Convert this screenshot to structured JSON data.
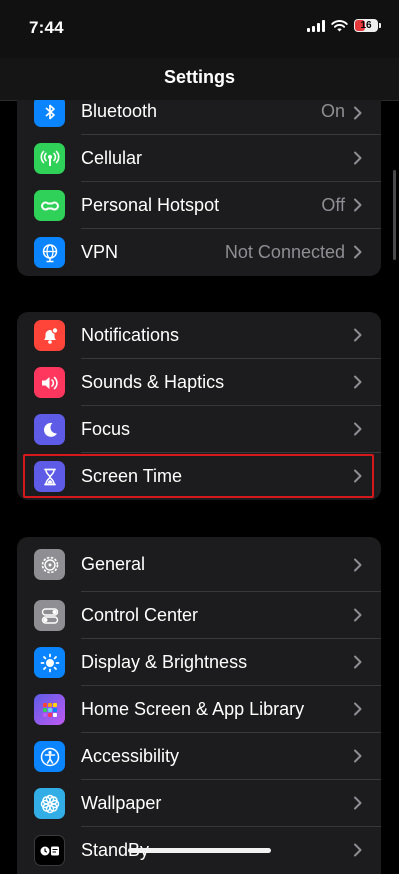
{
  "status_bar": {
    "time": "7:44",
    "battery": "16",
    "icons": [
      "cellular-signal-icon",
      "wifi-icon",
      "battery-icon"
    ]
  },
  "nav": {
    "title": "Settings"
  },
  "groups": [
    {
      "rows": [
        {
          "label": "Bluetooth",
          "value": "On",
          "icon": "bluetooth-icon",
          "color": "#0a84ff"
        },
        {
          "label": "Cellular",
          "value": "",
          "icon": "cellular-icon",
          "color": "#30d158"
        },
        {
          "label": "Personal Hotspot",
          "value": "Off",
          "icon": "hotspot-icon",
          "color": "#30d158"
        },
        {
          "label": "VPN",
          "value": "Not Connected",
          "icon": "vpn-globe-icon",
          "color": "#0a84ff"
        }
      ]
    },
    {
      "rows": [
        {
          "label": "Notifications",
          "value": "",
          "icon": "bell-icon",
          "color": "#ff453a"
        },
        {
          "label": "Sounds & Haptics",
          "value": "",
          "icon": "speaker-icon",
          "color": "#ff375f"
        },
        {
          "label": "Focus",
          "value": "",
          "icon": "moon-icon",
          "color": "#5e5ce6"
        },
        {
          "label": "Screen Time",
          "value": "",
          "icon": "hourglass-icon",
          "color": "#5e5ce6",
          "highlighted": true
        }
      ]
    },
    {
      "rows": [
        {
          "label": "General",
          "value": "",
          "icon": "gear-icon",
          "color": "#8e8e93"
        },
        {
          "label": "Control Center",
          "value": "",
          "icon": "toggles-icon",
          "color": "#8e8e93"
        },
        {
          "label": "Display & Brightness",
          "value": "",
          "icon": "sun-icon",
          "color": "#0a84ff"
        },
        {
          "label": "Home Screen & App Library",
          "value": "",
          "icon": "app-grid-icon",
          "color": "#5e5ce6"
        },
        {
          "label": "Accessibility",
          "value": "",
          "icon": "accessibility-icon",
          "color": "#0a84ff"
        },
        {
          "label": "Wallpaper",
          "value": "",
          "icon": "flower-icon",
          "color": "#32ade6"
        },
        {
          "label": "StandBy",
          "value": "",
          "icon": "standby-icon",
          "color": "#1c1c1e"
        }
      ]
    }
  ]
}
